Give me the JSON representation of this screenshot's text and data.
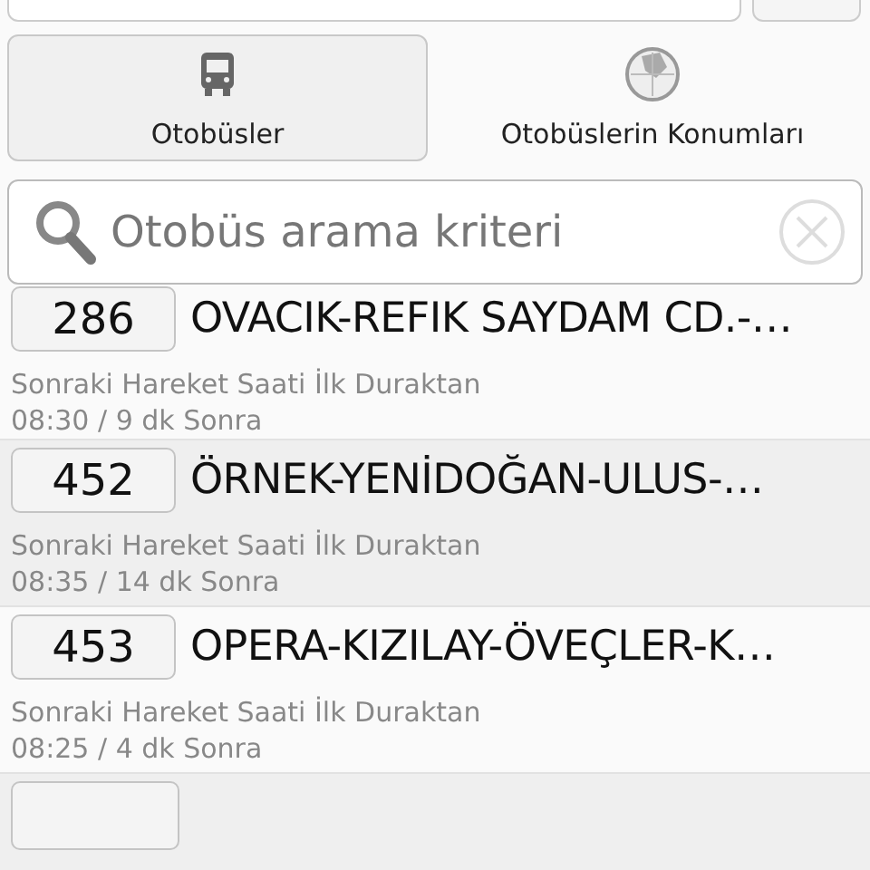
{
  "tabs": [
    {
      "label": "Otobüsler",
      "kind": "bus",
      "selected": true
    },
    {
      "label": "Otobüslerin Konumları",
      "kind": "globe",
      "selected": false
    }
  ],
  "search": {
    "placeholder": "Otobüs arama kriteri"
  },
  "routes": [
    {
      "number": "286",
      "title": "OVACIK-REFIK SAYDAM CD.-…",
      "subtitle": "Sonraki Hareket Saati İlk Duraktan",
      "time": "08:30 / 9 dk Sonra"
    },
    {
      "number": "452",
      "title": "ÖRNEK-YENİDOĞAN-ULUS-…",
      "subtitle": "Sonraki Hareket Saati İlk Duraktan",
      "time": "08:35 / 14 dk Sonra"
    },
    {
      "number": "453",
      "title": "OPERA-KIZILAY-ÖVEÇLER-K…",
      "subtitle": "Sonraki Hareket Saati İlk Duraktan",
      "time": "08:25 / 4 dk Sonra"
    }
  ]
}
